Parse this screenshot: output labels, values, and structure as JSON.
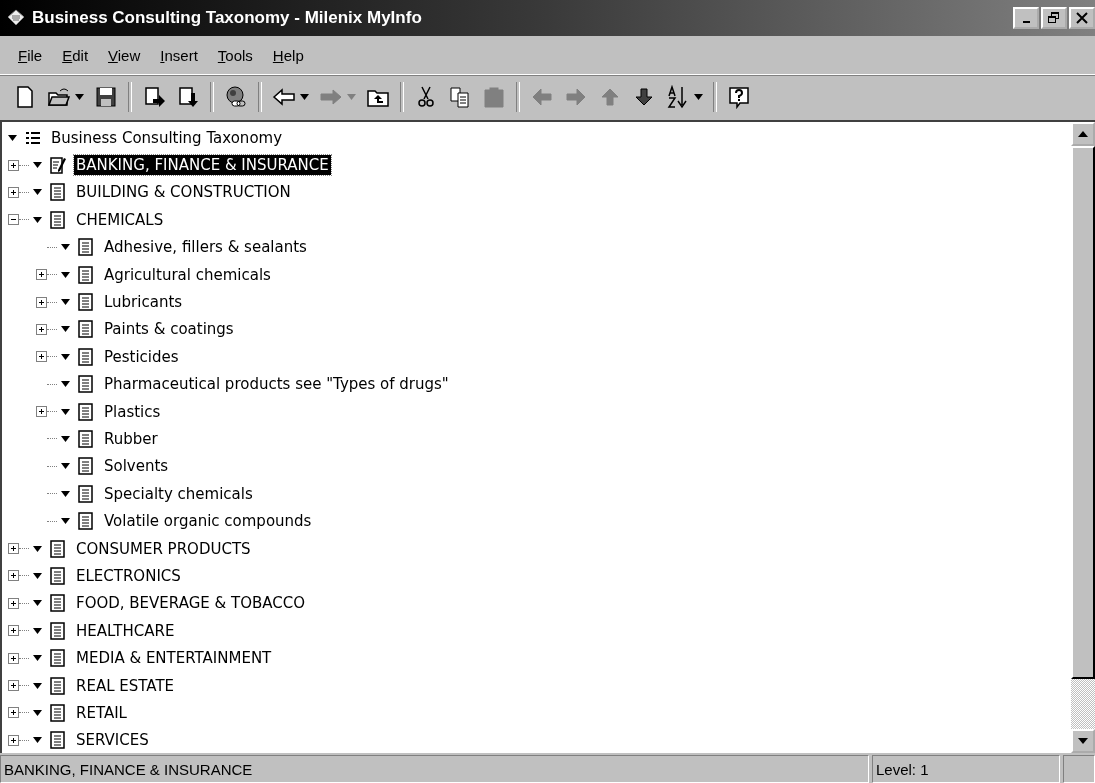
{
  "window": {
    "title": "Business Consulting Taxonomy - Milenix MyInfo"
  },
  "menu": [
    "File",
    "Edit",
    "View",
    "Insert",
    "Tools",
    "Help"
  ],
  "toolbar": [
    {
      "kind": "new",
      "disabled": false,
      "dropdown": false
    },
    {
      "kind": "open",
      "disabled": false,
      "dropdown": true
    },
    {
      "kind": "save",
      "disabled": false,
      "dropdown": false
    },
    {
      "kind": "separator"
    },
    {
      "kind": "import",
      "disabled": false,
      "dropdown": false
    },
    {
      "kind": "export",
      "disabled": false,
      "dropdown": false
    },
    {
      "kind": "separator"
    },
    {
      "kind": "globe",
      "disabled": false,
      "dropdown": false
    },
    {
      "kind": "separator"
    },
    {
      "kind": "back",
      "disabled": false,
      "dropdown": true
    },
    {
      "kind": "forward",
      "disabled": true,
      "dropdown": true
    },
    {
      "kind": "up-folder",
      "disabled": false,
      "dropdown": false
    },
    {
      "kind": "separator"
    },
    {
      "kind": "cut",
      "disabled": false,
      "dropdown": false
    },
    {
      "kind": "copy",
      "disabled": false,
      "dropdown": false
    },
    {
      "kind": "paste",
      "disabled": true,
      "dropdown": false
    },
    {
      "kind": "separator"
    },
    {
      "kind": "left",
      "disabled": true,
      "dropdown": false
    },
    {
      "kind": "right",
      "disabled": true,
      "dropdown": false
    },
    {
      "kind": "up",
      "disabled": true,
      "dropdown": false
    },
    {
      "kind": "down",
      "disabled": false,
      "dropdown": false
    },
    {
      "kind": "sort",
      "disabled": false,
      "dropdown": true
    },
    {
      "kind": "separator"
    },
    {
      "kind": "help",
      "disabled": false,
      "dropdown": false
    }
  ],
  "tree": {
    "root": "Business Consulting Taxonomy",
    "items": [
      {
        "label": "BANKING, FINANCE & INSURANCE",
        "kind": "branch",
        "expanded": false,
        "selected": true
      },
      {
        "label": "BUILDING & CONSTRUCTION",
        "kind": "branch",
        "expanded": false,
        "selected": false
      },
      {
        "label": "CHEMICALS",
        "kind": "branch",
        "expanded": true,
        "selected": false,
        "children": [
          {
            "label": "Adhesive, fillers & sealants",
            "kind": "leaf",
            "selected": false
          },
          {
            "label": "Agricultural chemicals",
            "kind": "branch",
            "expanded": false,
            "selected": false
          },
          {
            "label": "Lubricants",
            "kind": "branch",
            "expanded": false,
            "selected": false
          },
          {
            "label": "Paints & coatings",
            "kind": "branch",
            "expanded": false,
            "selected": false
          },
          {
            "label": "Pesticides",
            "kind": "branch",
            "expanded": false,
            "selected": false
          },
          {
            "label": "Pharmaceutical products see \"Types of drugs\"",
            "kind": "leaf",
            "selected": false
          },
          {
            "label": "Plastics",
            "kind": "branch",
            "expanded": false,
            "selected": false
          },
          {
            "label": "Rubber",
            "kind": "leaf",
            "selected": false
          },
          {
            "label": "Solvents",
            "kind": "leaf",
            "selected": false
          },
          {
            "label": "Specialty chemicals",
            "kind": "leaf",
            "selected": false
          },
          {
            "label": "Volatile organic compounds",
            "kind": "leaf",
            "selected": false
          }
        ]
      },
      {
        "label": "CONSUMER PRODUCTS",
        "kind": "branch",
        "expanded": false,
        "selected": false
      },
      {
        "label": "ELECTRONICS",
        "kind": "branch",
        "expanded": false,
        "selected": false
      },
      {
        "label": "FOOD, BEVERAGE & TOBACCO",
        "kind": "branch",
        "expanded": false,
        "selected": false
      },
      {
        "label": "HEALTHCARE",
        "kind": "branch",
        "expanded": false,
        "selected": false
      },
      {
        "label": "MEDIA & ENTERTAINMENT",
        "kind": "branch",
        "expanded": false,
        "selected": false
      },
      {
        "label": "REAL ESTATE",
        "kind": "branch",
        "expanded": false,
        "selected": false
      },
      {
        "label": "RETAIL",
        "kind": "branch",
        "expanded": false,
        "selected": false
      },
      {
        "label": "SERVICES",
        "kind": "branch",
        "expanded": false,
        "selected": false
      }
    ]
  },
  "status_bar": {
    "text": "BANKING, FINANCE & INSURANCE",
    "level": "Level: 1"
  }
}
